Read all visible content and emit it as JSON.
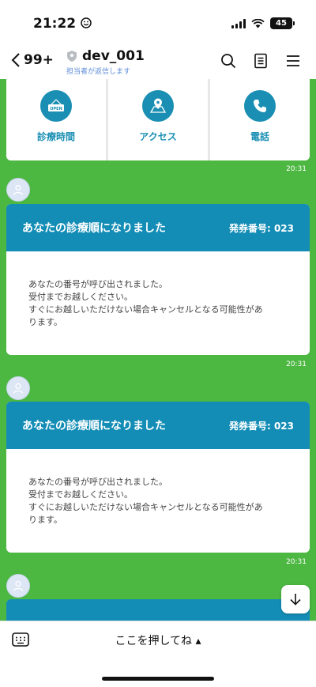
{
  "status_bar": {
    "time": "21:22",
    "battery": "45"
  },
  "header": {
    "back_count": "99+",
    "title": "dev_001",
    "subtitle": "担当者が返信します"
  },
  "menu": {
    "items": [
      {
        "label": "診療時間",
        "icon": "open-sign-icon"
      },
      {
        "label": "アクセス",
        "icon": "map-pin-icon"
      },
      {
        "label": "電話",
        "icon": "phone-icon"
      }
    ],
    "time": "20:31"
  },
  "messages": [
    {
      "title": "あなたの診療順になりました",
      "ticket_label": "発券番号: 023",
      "body_lines": [
        "あなたの番号が呼び出されました。",
        "受付までお越しください。",
        "すぐにお越しいただけない場合キャンセルとなる可能性があ",
        "ります。"
      ],
      "time": "20:31"
    },
    {
      "title": "あなたの診療順になりました",
      "ticket_label": "発券番号: 023",
      "body_lines": [
        "あなたの番号が呼び出されました。",
        "受付までお越しください。",
        "すぐにお越しいただけない場合キャンセルとなる可能性があ",
        "ります。"
      ],
      "time": "20:31"
    }
  ],
  "bottom_bar": {
    "menu_toggle": "ここを押してね ▴"
  },
  "colors": {
    "chat_bg": "#4cb741",
    "accent": "#138db6",
    "subtitle": "#5c8bd6"
  }
}
